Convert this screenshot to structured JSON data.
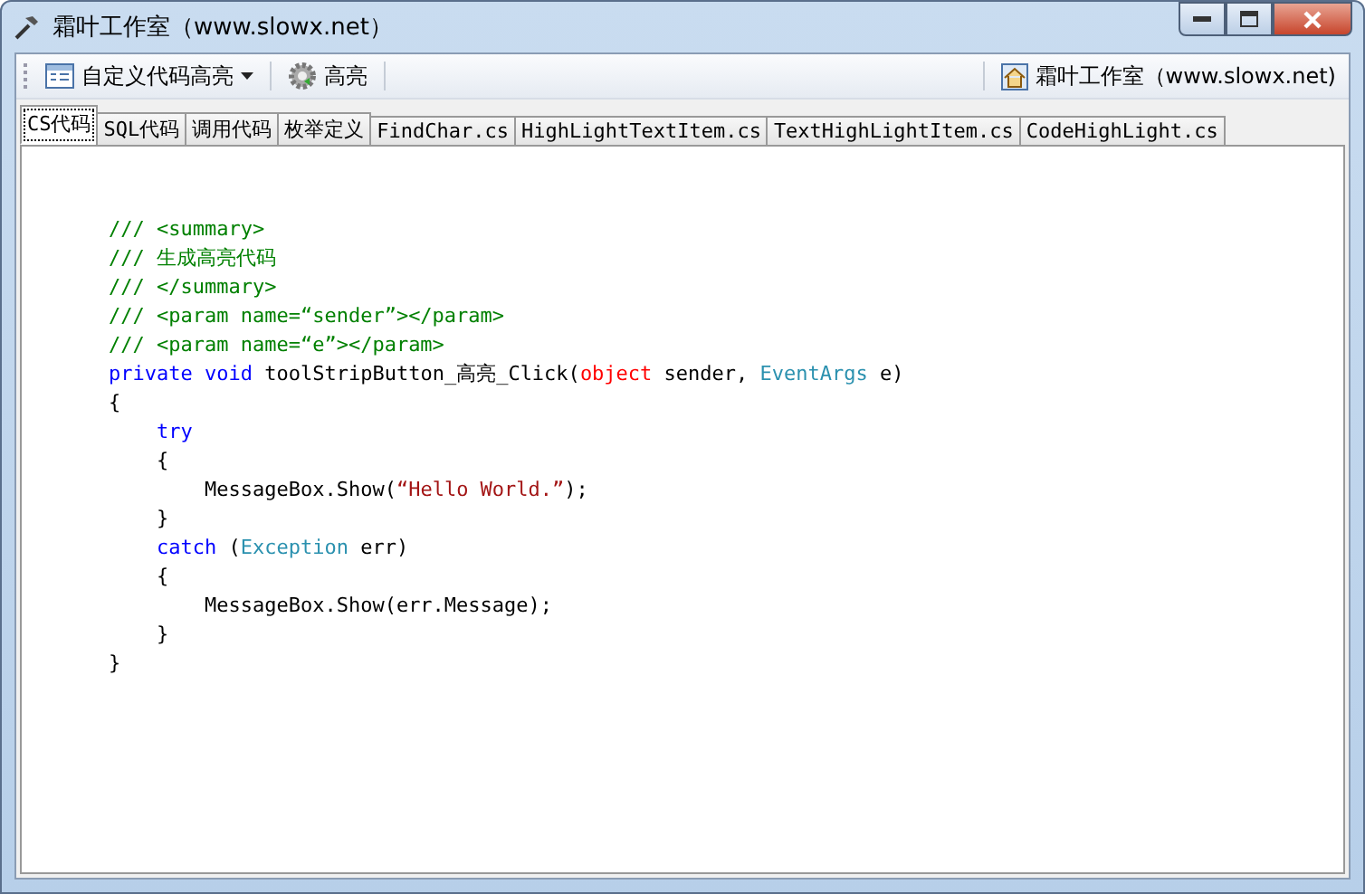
{
  "window": {
    "title": "霜叶工作室（www.slowx.net）"
  },
  "toolbar": {
    "left": [
      {
        "kind": "dropdown",
        "label": "自定义代码高亮"
      },
      {
        "kind": "button",
        "label": "高亮"
      }
    ],
    "right": {
      "label": "霜叶工作室（www.slowx.net)"
    }
  },
  "tabs": [
    {
      "label": "CS代码",
      "selected": true
    },
    {
      "label": "SQL代码",
      "selected": false
    },
    {
      "label": "调用代码",
      "selected": false
    },
    {
      "label": "枚举定义",
      "selected": false
    },
    {
      "label": "FindChar.cs",
      "selected": false
    },
    {
      "label": "HighLightTextItem.cs",
      "selected": false
    },
    {
      "label": "TextHighLightItem.cs",
      "selected": false
    },
    {
      "label": "CodeHighLight.cs",
      "selected": false
    }
  ],
  "code": [
    [
      {
        "kind": "comment",
        "text": "/// <summary>"
      }
    ],
    [
      {
        "kind": "comment",
        "text": "/// 生成高亮代码"
      }
    ],
    [
      {
        "kind": "comment",
        "text": "/// </summary>"
      }
    ],
    [
      {
        "kind": "comment",
        "text": "/// <param name=“sender”></param>"
      }
    ],
    [
      {
        "kind": "comment",
        "text": "/// <param name=“e”></param>"
      }
    ],
    [
      {
        "kind": "keyword",
        "text": "private void"
      },
      {
        "kind": "plain",
        "text": " toolStripButton_高亮_Click("
      },
      {
        "kind": "keyword2",
        "text": "object"
      },
      {
        "kind": "plain",
        "text": " sender, "
      },
      {
        "kind": "type",
        "text": "EventArgs"
      },
      {
        "kind": "plain",
        "text": " e)"
      }
    ],
    [
      {
        "kind": "plain",
        "text": "{"
      }
    ],
    [
      {
        "kind": "keyword",
        "text": "    try"
      }
    ],
    [
      {
        "kind": "plain",
        "text": "    {"
      }
    ],
    [
      {
        "kind": "plain",
        "text": "        MessageBox.Show("
      },
      {
        "kind": "string",
        "text": "“Hello World.”"
      },
      {
        "kind": "plain",
        "text": ");"
      }
    ],
    [
      {
        "kind": "plain",
        "text": "    }"
      }
    ],
    [
      {
        "kind": "keyword",
        "text": "    catch"
      },
      {
        "kind": "plain",
        "text": " ("
      },
      {
        "kind": "type",
        "text": "Exception"
      },
      {
        "kind": "plain",
        "text": " err)"
      }
    ],
    [
      {
        "kind": "plain",
        "text": "    {"
      }
    ],
    [
      {
        "kind": "plain",
        "text": "        MessageBox.Show(err.Message);"
      }
    ],
    [
      {
        "kind": "plain",
        "text": "    }"
      }
    ],
    [
      {
        "kind": "plain",
        "text": "}"
      }
    ]
  ]
}
